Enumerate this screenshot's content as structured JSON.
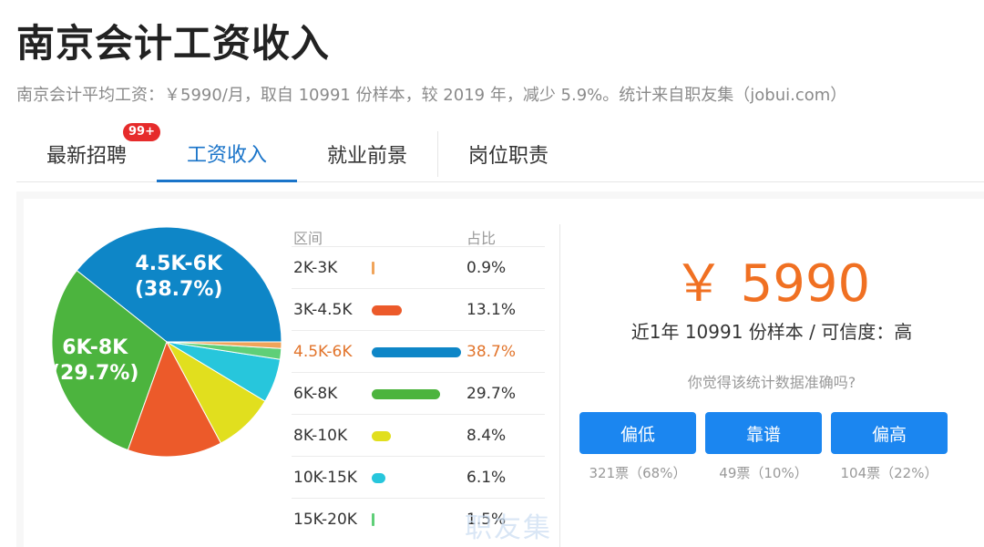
{
  "page": {
    "title": "南京会计工资收入",
    "subtitle": "南京会计平均工资：￥5990/月，取自 10991 份样本，较 2019 年，减少 5.9%。统计来自职友集（jobui.com）"
  },
  "tabs": [
    {
      "label": "最新招聘",
      "badge": "99+"
    },
    {
      "label": "工资收入"
    },
    {
      "label": "就业前景"
    },
    {
      "label": "岗位职责"
    }
  ],
  "table": {
    "header_range": "区间",
    "header_pct": "占比",
    "rows": [
      {
        "range": "2K-3K",
        "pct": "0.9%"
      },
      {
        "range": "3K-4.5K",
        "pct": "13.1%"
      },
      {
        "range": "4.5K-6K",
        "pct": "38.7%"
      },
      {
        "range": "6K-8K",
        "pct": "29.7%"
      },
      {
        "range": "8K-10K",
        "pct": "8.4%"
      },
      {
        "range": "10K-15K",
        "pct": "6.1%"
      },
      {
        "range": "15K-20K",
        "pct": "1.5%"
      }
    ]
  },
  "pie_labels": {
    "big": {
      "range": "4.5K-6K",
      "pct": "(38.7%)"
    },
    "second": {
      "range": "6K-8K",
      "pct": "(29.7%)"
    }
  },
  "stat": {
    "value": "￥ 5990",
    "sub": "近1年 10991 份样本 / 可信度：高",
    "question": "你觉得该统计数据准确吗?"
  },
  "votes": [
    {
      "label": "偏低",
      "count": "321票（68%）"
    },
    {
      "label": "靠谱",
      "count": "49票（10%）"
    },
    {
      "label": "偏高",
      "count": "104票（22%）"
    }
  ],
  "watermark": "职友集",
  "colors": {
    "accent_blue": "#1a74c9",
    "highlight_orange": "#e2742b",
    "stat_orange": "#f07022",
    "button_blue": "#1b86f0",
    "badge_red": "#e62b2b"
  },
  "chart_data": {
    "type": "pie",
    "categories": [
      "2K-3K",
      "3K-4.5K",
      "4.5K-6K",
      "6K-8K",
      "8K-10K",
      "10K-15K",
      "15K-20K"
    ],
    "values": [
      0.9,
      13.1,
      38.7,
      29.7,
      8.4,
      6.1,
      1.5
    ],
    "colors": [
      "#f0a45a",
      "#ec5a2a",
      "#0e86c7",
      "#4cb43e",
      "#e1df1e",
      "#27c6dc",
      "#5fcf78"
    ]
  }
}
